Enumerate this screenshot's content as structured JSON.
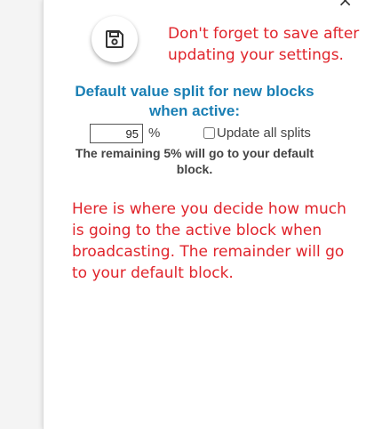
{
  "close_label": "×",
  "save": {
    "icon": "floppy-disk-icon",
    "note": "Don't forget to save after updating your settings."
  },
  "split": {
    "title": "Default value split for new blocks when active:",
    "value": "95",
    "unit": "%",
    "update_all_label": "Update all splits",
    "update_all_checked": false,
    "remaining_text": "The remaining 5% will go to your default block."
  },
  "explanation": "Here is where you decide how much is going to the active block when broadcasting. The remainder will go to your default block.",
  "colors": {
    "note_red": "#e0242b",
    "title_blue": "#1a7fb4"
  }
}
